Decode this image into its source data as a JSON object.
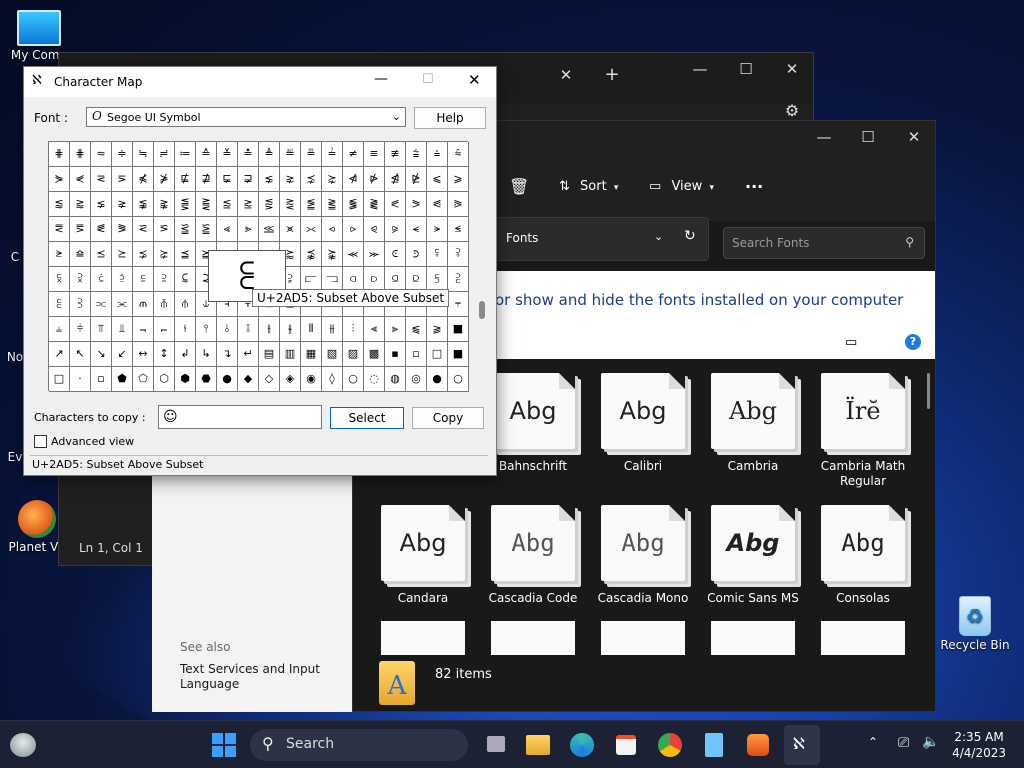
{
  "desktop": {
    "icons": [
      {
        "label": "My Comp"
      },
      {
        "label": "C"
      },
      {
        "label": "No"
      },
      {
        "label": "Ev"
      },
      {
        "label": "Planet VP"
      },
      {
        "label": "Recycle Bin"
      }
    ]
  },
  "back_window": {
    "new_tab": "+",
    "status": "Ln 1, Col 1"
  },
  "settings": {
    "see_also": "See also",
    "link": "Text Services and Input Language"
  },
  "explorer": {
    "sort_label": "Sort",
    "view_label": "View",
    "more_label": "···",
    "breadcrumb": "Fonts",
    "search_placeholder": "Search Fonts",
    "banner_text": "or show and hide the fonts installed on your computer",
    "items_count": "82 items",
    "fonts": [
      {
        "sample": "Abg",
        "name": "Bahnschrift"
      },
      {
        "sample": "Abg",
        "name": "Calibri"
      },
      {
        "sample": "Abg",
        "name": "Cambria"
      },
      {
        "sample": "Ïrĕ",
        "name": "Cambria Math Regular"
      },
      {
        "sample": "Abg",
        "name": "Candara"
      },
      {
        "sample": "Abg",
        "name": "Cascadia Code"
      },
      {
        "sample": "Abg",
        "name": "Cascadia Mono"
      },
      {
        "sample": "Abg",
        "name": "Comic Sans MS"
      },
      {
        "sample": "Abg",
        "name": "Consolas"
      }
    ]
  },
  "charmap": {
    "title": "Character Map",
    "font_label": "Font :",
    "font_value": "Segoe UI Symbol",
    "help_button": "Help",
    "zoomed_char": "⫕",
    "tooltip": "U+2AD5: Subset Above Subset",
    "copy_label": "Characters to copy :",
    "copy_value": "☺",
    "select_button": "Select",
    "copy_button": "Copy",
    "advanced_view": "Advanced view",
    "status": "U+2AD5: Subset Above Subset",
    "grid": [
      [
        "⋕",
        "⋕",
        "≈",
        "≑",
        "≒",
        "≓",
        "≔",
        "≙",
        "≚",
        "≛",
        "≜",
        "≝",
        "≞",
        "≟",
        "≠",
        "≡",
        "≢",
        "⩭",
        "⩮",
        "⩯"
      ],
      [
        "⋟",
        "⋞",
        "⋜",
        "⋝",
        "⋠",
        "⋡",
        "⋢",
        "⋣",
        "⋤",
        "⋥",
        "⋦",
        "⋧",
        "⋨",
        "⋩",
        "⋪",
        "⋫",
        "⋬",
        "⋭",
        "⩽",
        "⩾"
      ],
      [
        "⪅",
        "⪆",
        "⪇",
        "⪈",
        "⪉",
        "⪊",
        "⪋",
        "⪌",
        "⪍",
        "⪎",
        "⪏",
        "⪐",
        "⪑",
        "⪒",
        "⪓",
        "⪔",
        "⪕",
        "⪖",
        "⪗",
        "⪘"
      ],
      [
        "⪙",
        "⪚",
        "⪛",
        "⪜",
        "⪝",
        "⪞",
        "⪟",
        "⪠",
        "⪡",
        "⪢",
        "⪣",
        "⪤",
        "⪥",
        "⪦",
        "⪧",
        "⪨",
        "⪩",
        "⪪",
        "⪫",
        "⪬"
      ],
      [
        "⪭",
        "⪮",
        "⪯",
        "⪰",
        "⪱",
        "⪲",
        "⪳",
        "⪴",
        "⪵",
        "⪶",
        "⪷",
        "⪸",
        "⪹",
        "⪺",
        "⪻",
        "⪼",
        "⪽",
        "⪾",
        "⪿",
        "⫀"
      ],
      [
        "⫁",
        "⫂",
        "⫃",
        "⫄",
        "⫅",
        "⫆",
        "⫇",
        "⫈",
        "⫉",
        "⫊",
        "⫋",
        "⫌",
        "⫍",
        "⫎",
        "⫏",
        "⫐",
        "⫑",
        "⫒",
        "⫓",
        "⫔"
      ],
      [
        "⫕",
        "⫖",
        "⫗",
        "⫘",
        "⫙",
        "⫚",
        "⫛",
        "⫝",
        "⫞",
        "⫟",
        "⫠",
        "⫡",
        "⫢",
        "⫣",
        "⫤",
        "⫥",
        "⫦",
        "↑",
        "↓",
        "⫧"
      ],
      [
        "⫨",
        "⫩",
        "⫪",
        "⫫",
        "⫬",
        "⫭",
        "⫮",
        "⫯",
        "⫰",
        "⫱",
        "⫲",
        "⫳",
        "⫴",
        "⫵",
        "⫶",
        "⫷",
        "⫸",
        "⫹",
        "⫺",
        "■"
      ],
      [
        "↗",
        "↖",
        "↘",
        "↙",
        "↔",
        "↕",
        "↲",
        "↳",
        "↴",
        "↵",
        "▤",
        "▥",
        "▦",
        "▧",
        "▨",
        "▩",
        "▪",
        "▫",
        "□",
        "■"
      ],
      [
        "□",
        "·",
        "▫",
        "⬟",
        "⬠",
        "⬡",
        "⬢",
        "⬣",
        "●",
        "◆",
        "◇",
        "◈",
        "◉",
        "◊",
        "○",
        "◌",
        "◍",
        "◎",
        "●",
        "○"
      ]
    ]
  },
  "taskbar": {
    "search_label": "Search",
    "time": "2:35 AM",
    "date": "4/4/2023"
  }
}
